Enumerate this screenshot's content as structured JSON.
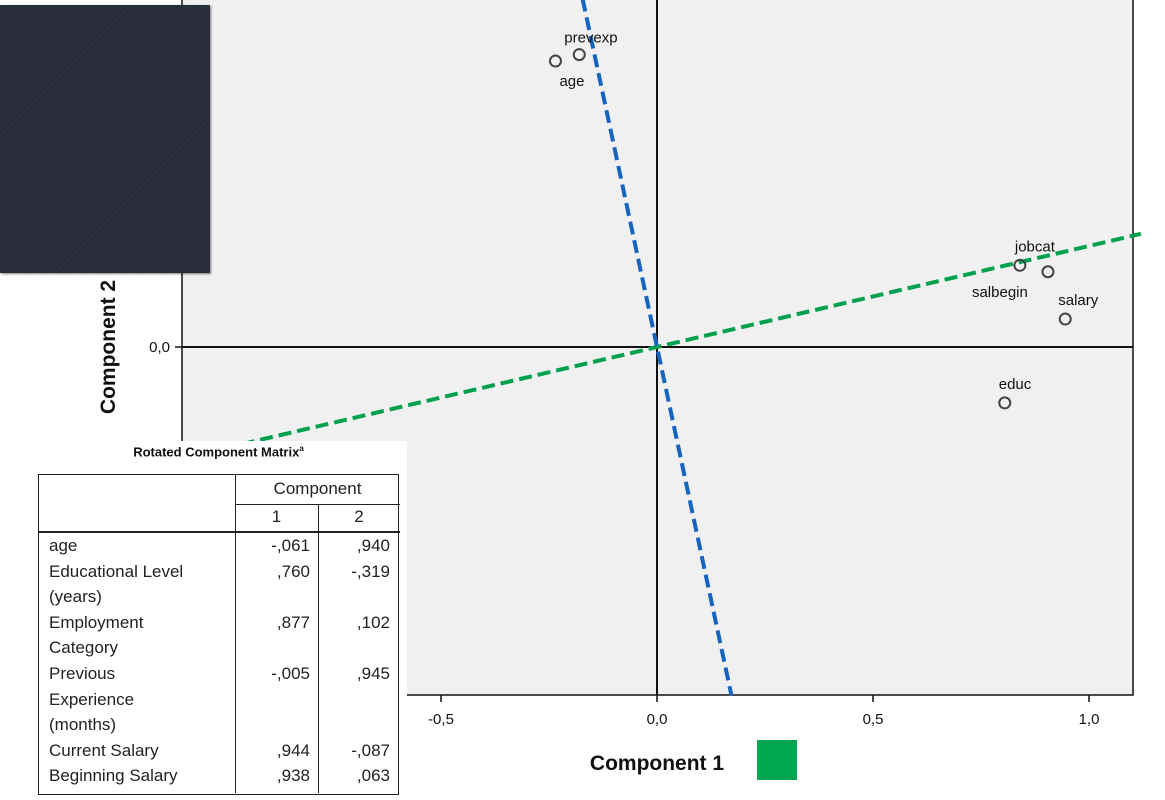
{
  "chart_data": [
    {
      "type": "scatter",
      "title": "",
      "xlabel": "Component 1",
      "ylabel": "Component 2",
      "xlim": [
        -1.2,
        1.1
      ],
      "ylim": [
        -0.82,
        0.8
      ],
      "xticks": [
        -0.5,
        0.0,
        0.5,
        1.0
      ],
      "xtick_labels": [
        "-0,5",
        "0,0",
        "0,5",
        "1,0"
      ],
      "yticks": [
        0.0
      ],
      "ytick_labels": [
        "0,0"
      ],
      "grid": false,
      "reference_lines": {
        "x": 0,
        "y": 0
      },
      "points": [
        {
          "label": "prevexp",
          "x": -0.18,
          "y": 0.68
        },
        {
          "label": "age",
          "x": -0.235,
          "y": 0.665
        },
        {
          "label": "jobcat",
          "x": 0.84,
          "y": 0.19
        },
        {
          "label": "salbegin",
          "x": 0.905,
          "y": 0.175
        },
        {
          "label": "salary",
          "x": 0.945,
          "y": 0.065
        },
        {
          "label": "educ",
          "x": 0.805,
          "y": -0.13
        }
      ],
      "rotated_axes": [
        {
          "color": "#00a14e",
          "dash": true,
          "slope": 0.235
        },
        {
          "color": "#1565c0",
          "dash": true,
          "slope": -4.7
        }
      ],
      "colors": {
        "points": "#444444",
        "axis": "#111111",
        "plot_bg": "#f0f0f0"
      }
    },
    {
      "type": "table",
      "title": "Rotated Component Matrix",
      "title_superscript": "a",
      "header": "Component",
      "columns": [
        "1",
        "2"
      ],
      "rows": [
        {
          "label": [
            "age"
          ],
          "values": [
            "-,061",
            ",940"
          ]
        },
        {
          "label": [
            "Educational Level",
            "(years)"
          ],
          "values": [
            ",760",
            "-,319"
          ]
        },
        {
          "label": [
            "Employment",
            "Category"
          ],
          "values": [
            ",877",
            ",102"
          ]
        },
        {
          "label": [
            "Previous",
            "Experience",
            "(months)"
          ],
          "values": [
            "-,005",
            ",945"
          ]
        },
        {
          "label": [
            "Current Salary"
          ],
          "values": [
            ",944",
            "-,087"
          ]
        },
        {
          "label": [
            "Beginning Salary"
          ],
          "values": [
            ",938",
            ",063"
          ]
        }
      ]
    }
  ],
  "colors": {
    "dark_panel": "#262c38",
    "green_swatch": "#00a650"
  }
}
